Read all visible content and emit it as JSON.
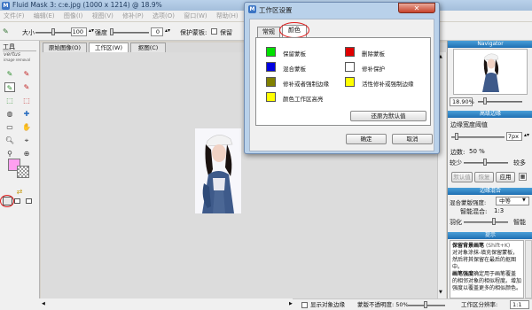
{
  "window": {
    "title": "Fluid Mask 3: c:e.jpg (1000 x 1214) @ 18.9%",
    "app_icon_glyph": "M"
  },
  "menu": [
    "文件(F)",
    "编辑(E)",
    "图像(I)",
    "视图(V)",
    "修补(P)",
    "选项(O)",
    "窗口(W)",
    "帮助(H)"
  ],
  "tool_options": {
    "size_label": "大小",
    "size_value": "100",
    "strength_label": "强度",
    "strength_value": "0",
    "protect_label": "保护蒙板:",
    "keep_label": "保留"
  },
  "tools_panel": {
    "title": "工具"
  },
  "doc_tabs": [
    "原始图像(O)",
    "工作区(W)",
    "抠图(C)"
  ],
  "doc_tab_active": 1,
  "dialog": {
    "title": "工作区设置",
    "tabs": [
      "常规",
      "颜色"
    ],
    "active_tab": 1,
    "color_items": [
      {
        "label": "保留蒙板",
        "color": "#00e000"
      },
      {
        "label": "删除蒙板",
        "color": "#e00000"
      },
      {
        "label": "混合蒙板",
        "color": "#0000e0"
      },
      {
        "label": "修补保护",
        "color": "#ffffff"
      },
      {
        "label": "修补或者强制边缘",
        "color": "#808000"
      },
      {
        "label": "活性修补或强制边缘",
        "color": "#ffff00"
      },
      {
        "label": "颜色工作区高亮",
        "color": "#ffff00"
      }
    ],
    "reset_button": "还原为默认值",
    "ok_button": "确定",
    "cancel_button": "取消"
  },
  "right_panel": {
    "navigator": {
      "title": "Navigator",
      "zoom": "18.90%"
    },
    "edge": {
      "title": "高级边缘",
      "width_label": "边缘宽度阈值",
      "width_value": "7px",
      "degree_label": "边数:",
      "degree_value": "50 %",
      "less_label": "较少",
      "more_label": "较多",
      "default_button": "默认值",
      "restore_button": "恢复",
      "apply_button": "应用"
    },
    "blend": {
      "title": "边缘混合",
      "strength_label": "混合蒙版强度:",
      "strength_value": "中等",
      "smart_label": "智能混合:",
      "smart_value": "1:3",
      "feather_label": "羽化",
      "smart2_label": "智能"
    },
    "tips": {
      "title": "提示",
      "heading": "保留背景画笔",
      "shortcut": "(Shift+K)",
      "body1": "对对象涂抹-填充保留蒙板，然后将其保留在最后的抠图中。",
      "heading2": "画笔强度",
      "body2": "确定用于画笔覆盖的相邻对象的相似程度。增加强度以覆盖更多的相似颜色。"
    }
  },
  "status": {
    "show_edges": "显示对象边缘",
    "mask_opacity": "蒙版不透明度: 50%",
    "resolution_label": "工作区分辨率:",
    "resolution_value": "1:1"
  },
  "colors": {
    "title_bar": "#b9d1ea",
    "panel_header": "#1f6fb3",
    "callout": "#e02020"
  }
}
